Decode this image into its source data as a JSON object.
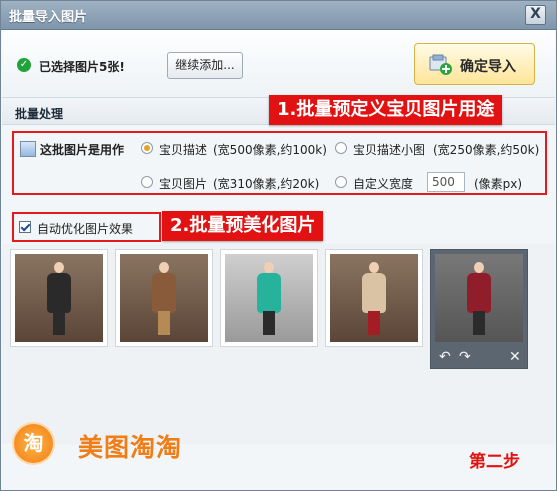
{
  "window": {
    "title": "批量导入图片",
    "close_glyph": "X"
  },
  "top": {
    "selected_text": "已选择图片5张!",
    "add_more_label": "继续添加...",
    "confirm_label": "确定导入"
  },
  "section": {
    "title": "批量处理"
  },
  "purpose": {
    "label": "这批图片是用作",
    "options": [
      {
        "label": "宝贝描述",
        "note": "(宽500像素,约100k)",
        "selected": true
      },
      {
        "label": "宝贝描述小图",
        "note": "(宽250像素,约50k)",
        "selected": false
      },
      {
        "label": "宝贝图片",
        "note": "(宽310像素,约20k)",
        "selected": false
      },
      {
        "label": "自定义宽度",
        "note": "",
        "selected": false
      }
    ],
    "custom_width": "500",
    "unit": "(像素px)"
  },
  "callouts": {
    "one": "1.批量预定义宝贝图片用途",
    "two": "2.批量预美化图片"
  },
  "optimize": {
    "label": "自动优化图片效果",
    "checked": true
  },
  "thumbnails": [
    {
      "name": "photo-1"
    },
    {
      "name": "photo-2"
    },
    {
      "name": "photo-3"
    },
    {
      "name": "photo-4"
    },
    {
      "name": "photo-5",
      "active": true
    }
  ],
  "thumb_tools": {
    "undo": "↶",
    "redo": "↷",
    "remove": "✕"
  },
  "footer": {
    "logo_char": "淘",
    "brand": "美图淘淘",
    "step": "第二步"
  },
  "colors": {
    "accent_red": "#e21212",
    "brand_orange": "#f07d15"
  }
}
